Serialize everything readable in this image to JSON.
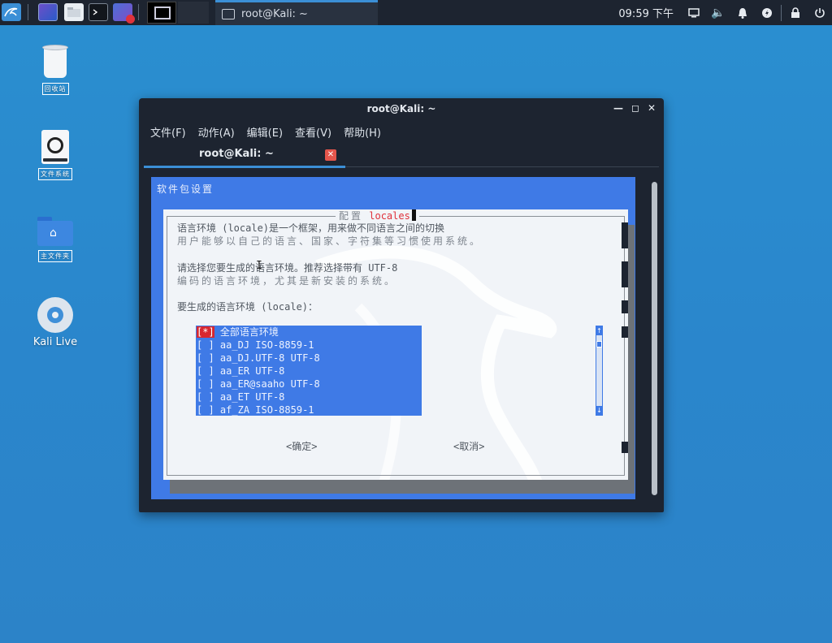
{
  "panel": {
    "clock": "09:59 下午",
    "task_title": "root@Kali: ~",
    "tray_icons": [
      "display-icon",
      "volume-icon",
      "bell-icon",
      "power-icon",
      "lock-icon",
      "logout-icon"
    ]
  },
  "desktop": {
    "icons": [
      {
        "name": "trash",
        "label": "回收站"
      },
      {
        "name": "filesystem",
        "label": "文件系统"
      },
      {
        "name": "home",
        "label": "主文件夹"
      },
      {
        "name": "kali-live",
        "label": "Kali Live"
      }
    ]
  },
  "window": {
    "title": "root@Kali: ~",
    "menu": [
      "文件(F)",
      "动作(A)",
      "编辑(E)",
      "查看(V)",
      "帮助(H)"
    ],
    "tab_label": "root@Kali: ~"
  },
  "terminal": {
    "backtitle": "软件包设置",
    "dialog_title_prefix": "配置",
    "dialog_title": "locales",
    "line1a": "语言环境 (locale)是一个框架，用来做不同语言之间的切换",
    "line1b": "用户能够以自己的语言、国家、字符集等习惯使用系统。",
    "line2a": "请选择您要生成的语言环境。推荐选择带有 UTF-8",
    "line2b": "编码的语言环境，尤其是新安装的系统。",
    "line3": "要生成的语言环境 (locale)：",
    "items": [
      {
        "check": "[*]",
        "label": "全部语言环境"
      },
      {
        "check": "[ ]",
        "label": "aa_DJ ISO-8859-1"
      },
      {
        "check": "[ ]",
        "label": "aa_DJ.UTF-8 UTF-8"
      },
      {
        "check": "[ ]",
        "label": "aa_ER UTF-8"
      },
      {
        "check": "[ ]",
        "label": "aa_ER@saaho UTF-8"
      },
      {
        "check": "[ ]",
        "label": "aa_ET UTF-8"
      },
      {
        "check": "[ ]",
        "label": "af_ZA ISO-8859-1"
      }
    ],
    "ok_button": "<确定>",
    "cancel_button": "<取消>"
  }
}
